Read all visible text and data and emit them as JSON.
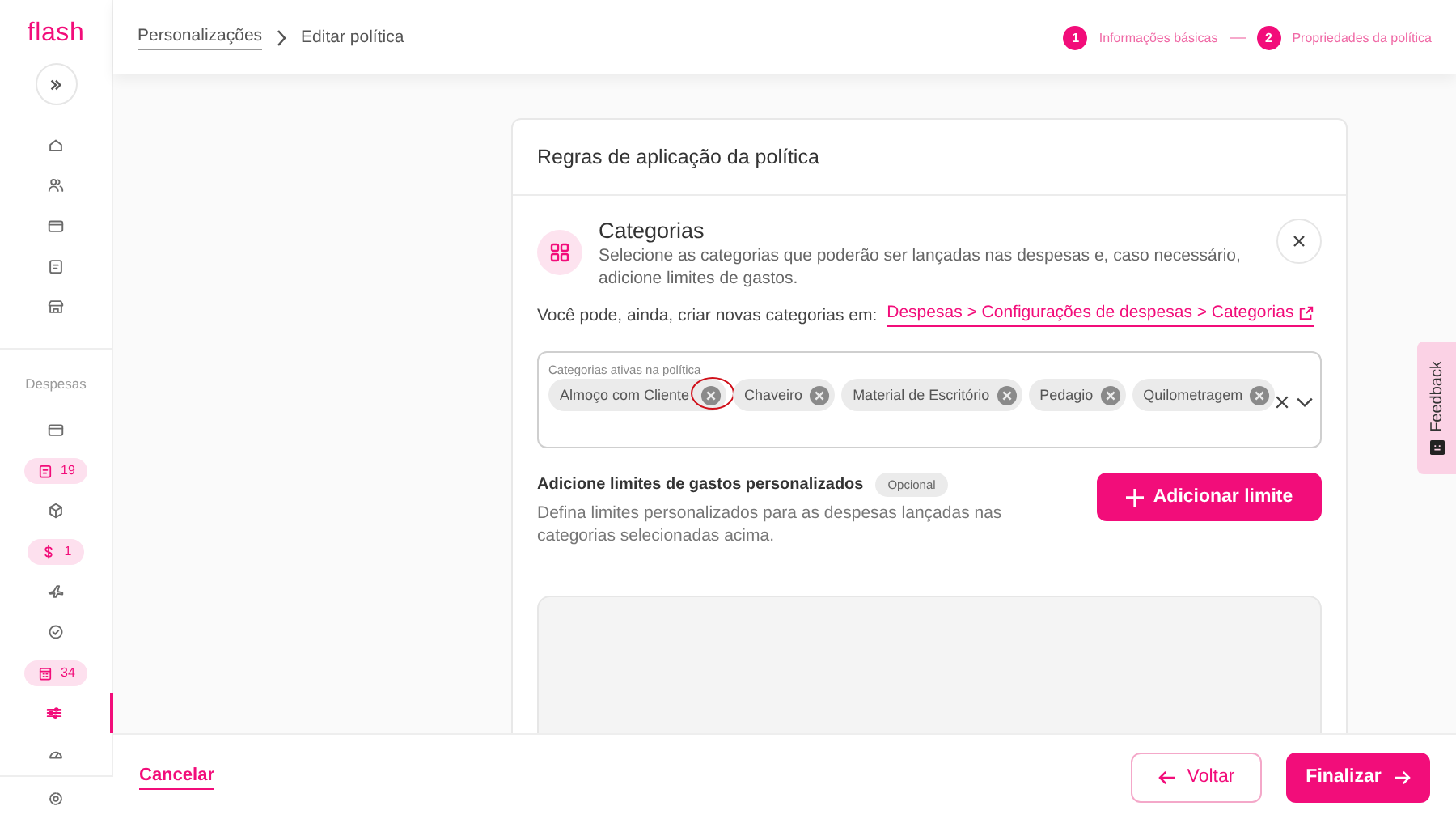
{
  "logo": "flash",
  "breadcrumb": [
    {
      "label": "Personalizações",
      "kind": "link"
    },
    {
      "label": "Editar política",
      "kind": "current"
    }
  ],
  "stepper": [
    {
      "number": "1",
      "label": "Informações básicas"
    },
    {
      "number": "2",
      "label": "Propriedades da política"
    }
  ],
  "sidebar": {
    "top_items": [
      {
        "selected": false
      },
      {
        "selected": false
      },
      {
        "selected": false
      },
      {
        "selected": false
      },
      {
        "selected": false
      }
    ],
    "section_label": "Despesas",
    "section_items": [
      {
        "selected": false
      },
      {
        "badge": "19",
        "selected": false
      },
      {
        "selected": false
      },
      {
        "badge": "1",
        "selected": false
      },
      {
        "selected": false
      },
      {
        "selected": false
      },
      {
        "badge": "34",
        "selected": false
      },
      {
        "selected": true
      },
      {
        "selected": false
      }
    ]
  },
  "card": {
    "title": "Regras de aplicação da política",
    "section": {
      "title": "Categorias",
      "description": "Selecione as categorias que poderão ser lançadas nas despesas e, caso necessário, adicione limites de gastos.",
      "note": "Você pode, ainda, criar novas categorias em:",
      "link": "Despesas > Configurações de despesas > Categorias",
      "field": {
        "label": "Categorias ativas na política",
        "chips": [
          {
            "label": "Almoço com Cliente",
            "annotated": true
          },
          {
            "label": "Chaveiro",
            "annotated": false
          },
          {
            "label": "Material de Escritório",
            "annotated": false
          },
          {
            "label": "Pedagio",
            "annotated": false
          },
          {
            "label": "Quilometragem",
            "annotated": false
          }
        ]
      },
      "limits": {
        "title": "Adicione limites de gastos personalizados",
        "tag": "Opcional",
        "description": "Defina limites personalizados para as despesas lançadas nas categorias selecionadas acima.",
        "button": "Adicionar limite"
      }
    }
  },
  "footer": {
    "cancel": "Cancelar",
    "back": "Voltar",
    "finish": "Finalizar"
  },
  "feedback": "Feedback"
}
